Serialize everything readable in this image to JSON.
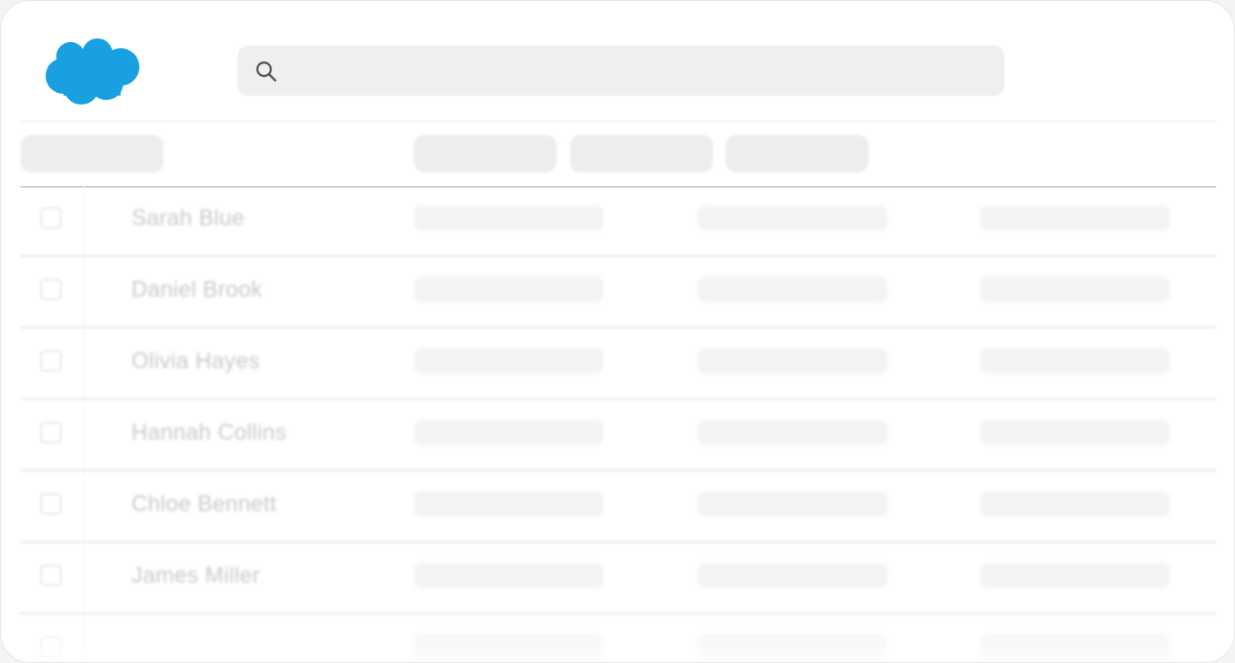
{
  "brand": {
    "logo_icon": "salesforce-cloud-icon",
    "logo_color": "#1798c1"
  },
  "search": {
    "icon": "search-icon",
    "placeholder": "",
    "value": ""
  },
  "records": [
    {
      "name": "Sarah Blue"
    },
    {
      "name": "Daniel Brook"
    },
    {
      "name": "Olivia Hayes"
    },
    {
      "name": "Hannah Collins"
    },
    {
      "name": "Chloe Bennett"
    },
    {
      "name": "James Miller"
    },
    {
      "name": ""
    }
  ],
  "colors": {
    "background": "#ffffff",
    "placeholder_gray": "#ededed",
    "header_rule": "#cfcfcf"
  }
}
